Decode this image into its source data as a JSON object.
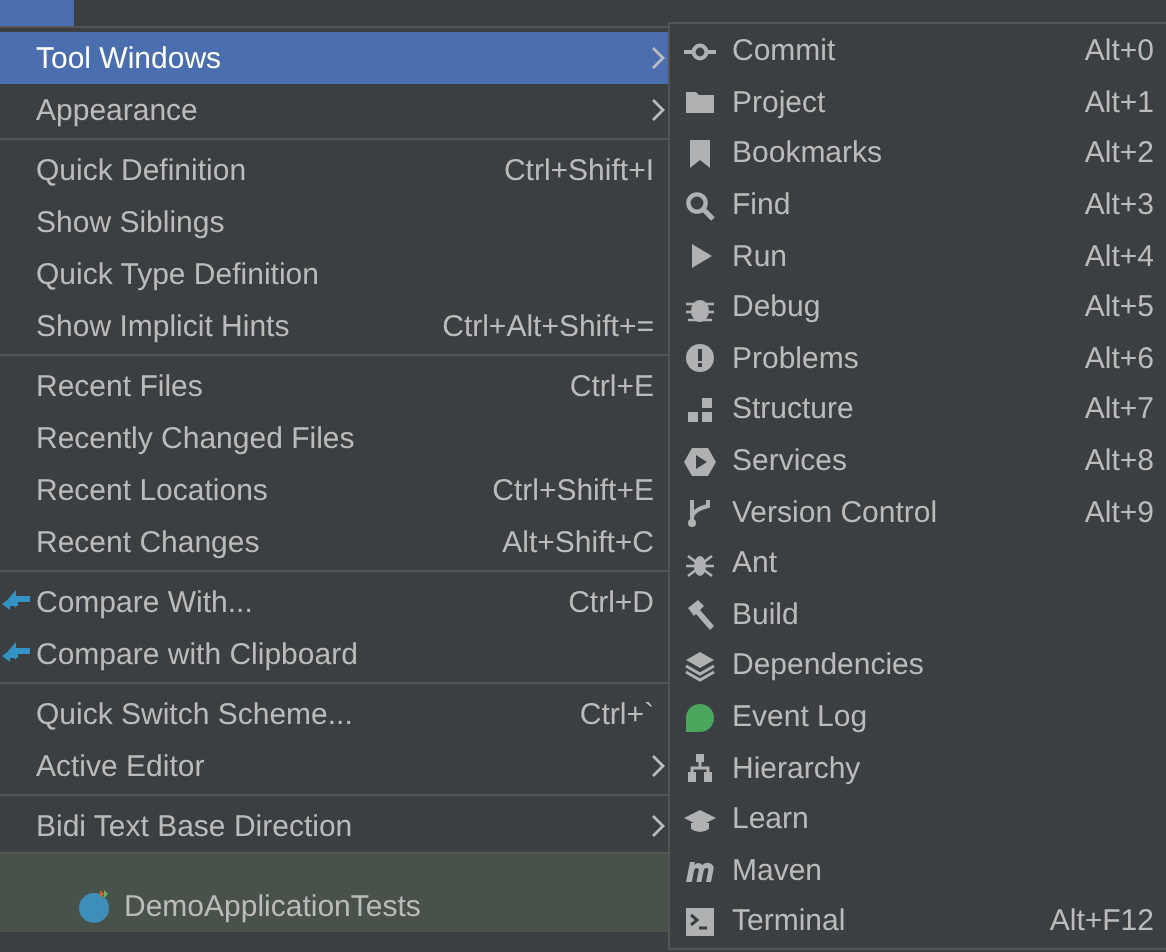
{
  "view_menu": {
    "items": [
      {
        "kind": "item",
        "label": "Tool Windows",
        "submenu": true,
        "selected": true
      },
      {
        "kind": "item",
        "label": "Appearance",
        "submenu": true,
        "selected": false
      },
      {
        "kind": "separator"
      },
      {
        "kind": "item",
        "label": "Quick Definition",
        "shortcut": "Ctrl+Shift+I",
        "submenu": false,
        "selected": false
      },
      {
        "kind": "item",
        "label": "Show Siblings",
        "submenu": false,
        "selected": false
      },
      {
        "kind": "item",
        "label": "Quick Type Definition",
        "submenu": false,
        "selected": false
      },
      {
        "kind": "item",
        "label": "Show Implicit Hints",
        "shortcut": "Ctrl+Alt+Shift+=",
        "submenu": false,
        "selected": false
      },
      {
        "kind": "separator"
      },
      {
        "kind": "item",
        "label": "Recent Files",
        "shortcut": "Ctrl+E",
        "submenu": false,
        "selected": false
      },
      {
        "kind": "item",
        "label": "Recently Changed Files",
        "submenu": false,
        "selected": false
      },
      {
        "kind": "item",
        "label": "Recent Locations",
        "shortcut": "Ctrl+Shift+E",
        "submenu": false,
        "selected": false
      },
      {
        "kind": "item",
        "label": "Recent Changes",
        "shortcut": "Alt+Shift+C",
        "submenu": false,
        "selected": false
      },
      {
        "kind": "separator"
      },
      {
        "kind": "icon_item",
        "label": "Compare With...",
        "shortcut": "Ctrl+D",
        "submenu": false,
        "selected": false
      },
      {
        "kind": "icon_item",
        "label": "Compare with Clipboard",
        "submenu": false,
        "selected": false
      },
      {
        "kind": "separator"
      },
      {
        "kind": "item",
        "label": "Quick Switch Scheme...",
        "shortcut": "Ctrl+`",
        "submenu": false,
        "selected": false
      },
      {
        "kind": "item",
        "label": "Active Editor",
        "submenu": true,
        "selected": false
      },
      {
        "kind": "separator"
      },
      {
        "kind": "item",
        "label": "Bidi Text Base Direction",
        "submenu": true,
        "selected": false
      }
    ]
  },
  "tool_windows_menu": {
    "items": [
      {
        "label": "Commit",
        "shortcut": "Alt+0"
      },
      {
        "label": "Project",
        "shortcut": "Alt+1"
      },
      {
        "label": "Bookmarks",
        "shortcut": "Alt+2"
      },
      {
        "label": "Find",
        "shortcut": "Alt+3"
      },
      {
        "label": "Run",
        "shortcut": "Alt+4"
      },
      {
        "label": "Debug",
        "shortcut": "Alt+5"
      },
      {
        "label": "Problems",
        "shortcut": "Alt+6"
      },
      {
        "label": "Structure",
        "shortcut": "Alt+7"
      },
      {
        "label": "Services",
        "shortcut": "Alt+8"
      },
      {
        "label": "Version Control",
        "shortcut": "Alt+9"
      },
      {
        "label": "Ant"
      },
      {
        "label": "Build"
      },
      {
        "label": "Dependencies"
      },
      {
        "label": "Event Log"
      },
      {
        "label": "Hierarchy"
      },
      {
        "label": "Learn"
      },
      {
        "label": "Maven"
      },
      {
        "label": "Terminal",
        "shortcut": "Alt+F12"
      }
    ]
  },
  "project_tree": [
    {
      "kind": "class",
      "label": "DemoApplicationTests"
    }
  ]
}
